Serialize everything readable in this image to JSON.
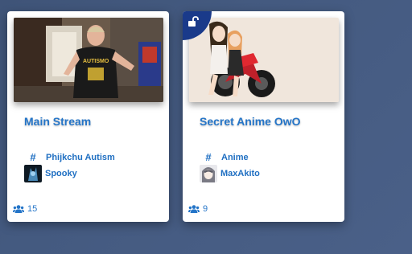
{
  "streams": [
    {
      "title": "Main Stream",
      "tag": "Phijkchu Autism",
      "user": "Spooky",
      "viewers": "15",
      "locked": false,
      "icons": {
        "tag": "hashtag-icon",
        "viewers": "users-icon"
      }
    },
    {
      "title": "Secret Anime OwO",
      "tag": "Anime",
      "user": "MaxAkito",
      "viewers": "9",
      "locked": true,
      "icons": {
        "tag": "hashtag-icon",
        "viewers": "users-icon",
        "badge": "unlock-icon"
      }
    }
  ],
  "colors": {
    "accent": "#2575c8",
    "badge": "#1a3a8a",
    "background": "#445a80"
  }
}
